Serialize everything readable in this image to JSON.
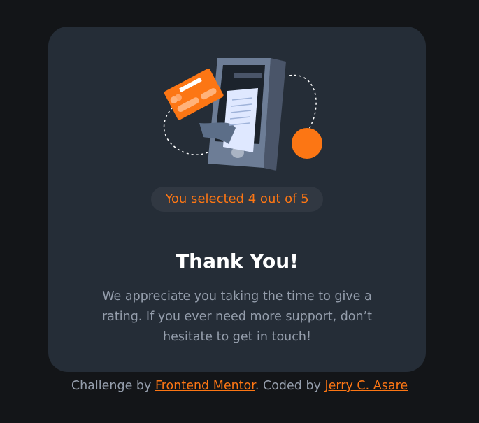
{
  "rating_card": {
    "selected_text": "You selected 4 out of 5",
    "title": "Thank You!",
    "message_lines": [
      "We appreciate you taking the time to give a",
      "rating. If you ever need more support, don’t",
      "hesitate to get in touch!"
    ]
  },
  "attribution": {
    "prefix": "Challenge by ",
    "challenge_link": "Frontend Mentor",
    "middle": ". Coded by ",
    "author_link": "Jerry C. Asare"
  },
  "colors": {
    "background": "#131518",
    "card": "#252d37",
    "accent": "#fc7614",
    "text_muted": "#959eac",
    "pill_bg": "#313842"
  }
}
